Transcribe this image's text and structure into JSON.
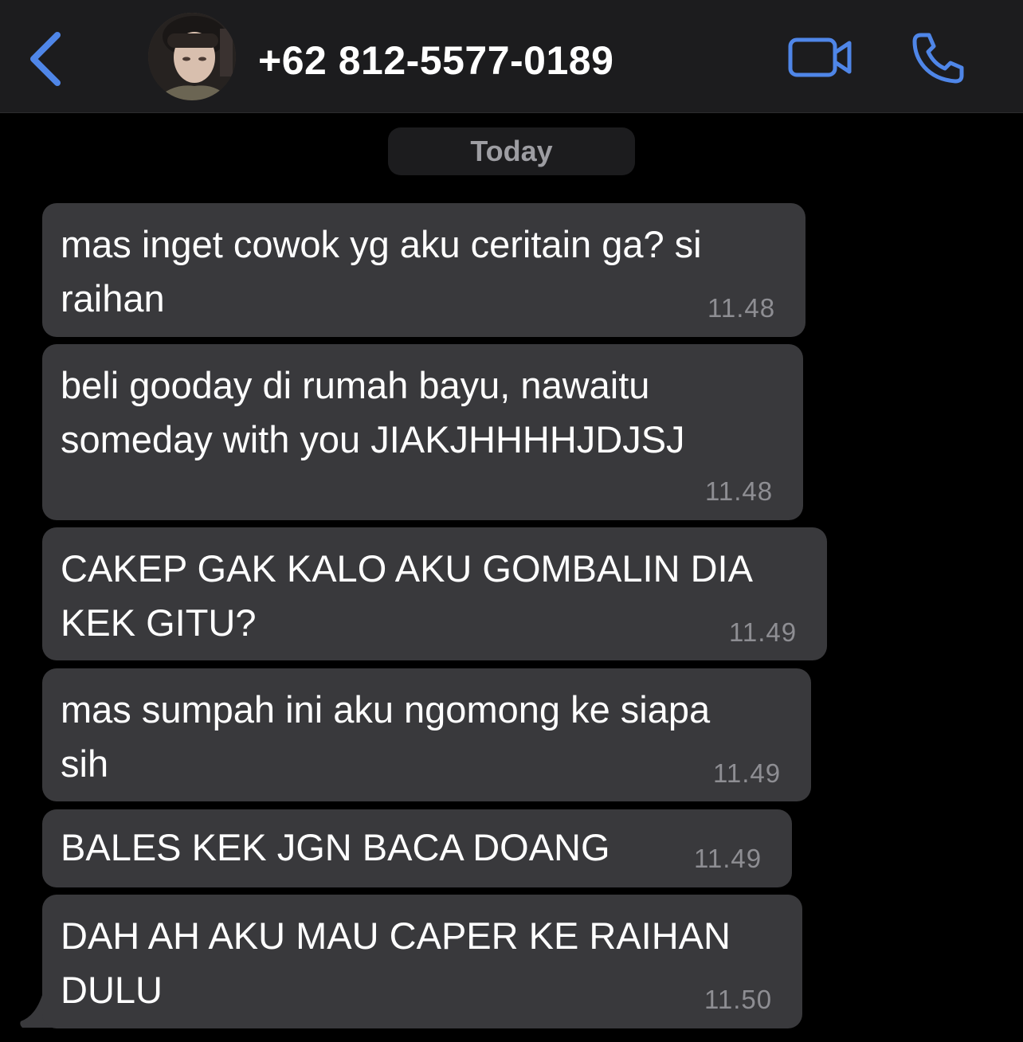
{
  "header": {
    "contact_name": "+62 812-5577-0189",
    "back_icon": "chevron-left-icon",
    "video_icon": "video-camera-icon",
    "call_icon": "phone-icon"
  },
  "date_separator": "Today",
  "colors": {
    "accent": "#4f86e8",
    "bubble": "#39393c",
    "header_bg": "#1c1c1e",
    "background": "#000000"
  },
  "messages": [
    {
      "lines": [
        "mas inget cowok yg aku ceritain ga? si",
        "raihan"
      ],
      "time": "11.48"
    },
    {
      "lines": [
        "beli gooday di rumah bayu, nawaitu",
        "someday with you JIAKJHHHHJDJSJ"
      ],
      "time": "11.48"
    },
    {
      "lines": [
        "CAKEP GAK KALO AKU GOMBALIN DIA",
        "KEK GITU?"
      ],
      "time": "11.49"
    },
    {
      "lines": [
        "mas sumpah ini aku ngomong ke siapa",
        "sih"
      ],
      "time": "11.49"
    },
    {
      "lines": [
        "BALES KEK JGN BACA DOANG"
      ],
      "time": "11.49"
    },
    {
      "lines": [
        "DAH AH AKU MAU CAPER KE RAIHAN",
        "DULU"
      ],
      "time": "11.50"
    }
  ]
}
